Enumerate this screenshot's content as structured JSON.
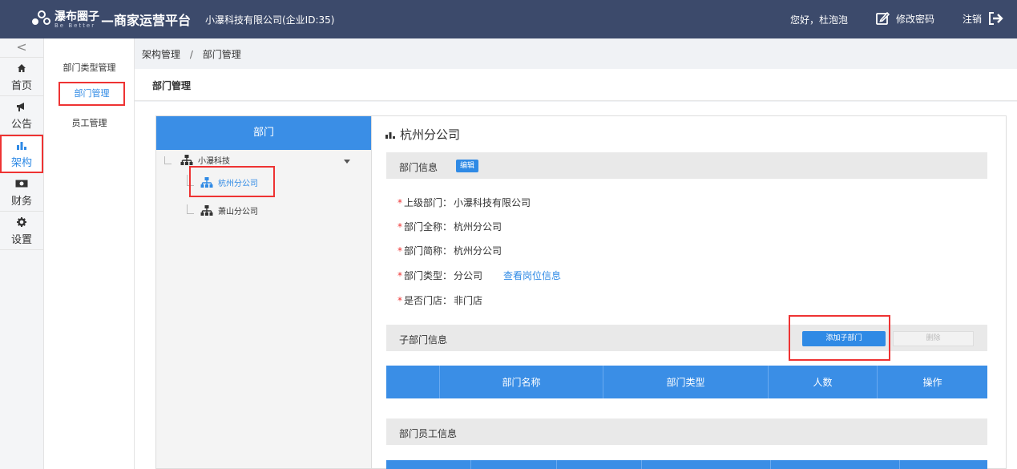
{
  "header": {
    "brand": "瀑布圈子",
    "brand_sub": "Be Better",
    "platform": "—商家运营平台",
    "company": "小瀑科技有限公司(企业ID:35)",
    "greeting": "您好，杜泡泡",
    "change_password": "修改密码",
    "logout": "注销"
  },
  "icon_nav": {
    "collapse": "<",
    "items": [
      {
        "label": "首页",
        "icon": "home-icon"
      },
      {
        "label": "公告",
        "icon": "megaphone-icon"
      },
      {
        "label": "架构",
        "icon": "bar-chart-icon"
      },
      {
        "label": "财务",
        "icon": "money-icon"
      },
      {
        "label": "设置",
        "icon": "gear-icon"
      }
    ]
  },
  "sub_nav": {
    "items": [
      "部门类型管理",
      "部门管理",
      "员工管理"
    ]
  },
  "breadcrumb": {
    "parent": "架构管理",
    "separator": "/",
    "current": "部门管理"
  },
  "page_title": "部门管理",
  "tree": {
    "header": "部门",
    "root": "小瀑科技",
    "children": [
      "杭州分公司",
      "萧山分公司"
    ]
  },
  "detail": {
    "title": "杭州分公司",
    "info_section": "部门信息",
    "edit_label": "编辑",
    "fields": [
      {
        "label": "上级部门：",
        "value": "小瀑科技有限公司"
      },
      {
        "label": "部门全称：",
        "value": "杭州分公司"
      },
      {
        "label": "部门简称：",
        "value": "杭州分公司"
      },
      {
        "label": "部门类型：",
        "value": "分公司",
        "link": "查看岗位信息"
      },
      {
        "label": "是否门店：",
        "value": "非门店"
      }
    ],
    "child_section": "子部门信息",
    "add_child_label": "添加子部门",
    "delete_label": "删除",
    "table_headers": [
      "",
      "部门名称",
      "部门类型",
      "人数",
      "操作"
    ],
    "staff_section": "部门员工信息"
  },
  "colors": {
    "header_bg": "#3c4a6b",
    "accent": "#3a8ee6",
    "highlight_red": "#e33"
  }
}
